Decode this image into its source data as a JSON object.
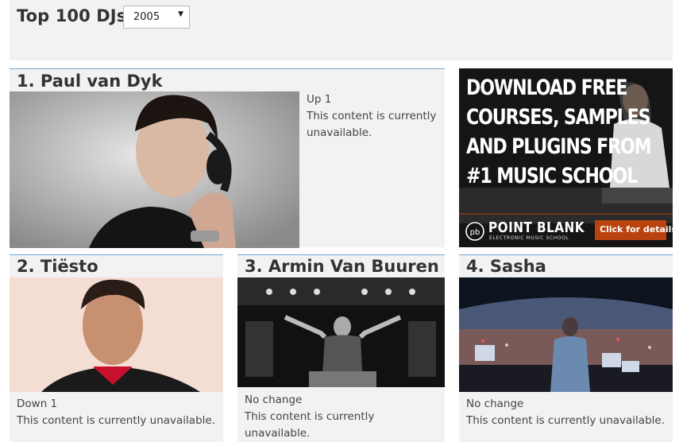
{
  "header": {
    "title": "Top 100 DJs",
    "year_select": {
      "value": "2005"
    }
  },
  "djs": [
    {
      "title": "1. Paul van Dyk",
      "change": "Up 1",
      "status": "This content is currently unavailable."
    },
    {
      "title": "2. Tiësto",
      "change": "Down 1",
      "status": "This content is currently unavailable."
    },
    {
      "title": "3. Armin Van Buuren",
      "change": "No change",
      "status": "This content is currently unavailable."
    },
    {
      "title": "4. Sasha",
      "change": "No change",
      "status": "This content is currently unavailable."
    }
  ],
  "ad": {
    "headline_lines": [
      "DOWNLOAD FREE",
      "COURSES, SAMPLES",
      "AND PLUGINS FROM",
      "#1 MUSIC SCHOOL"
    ],
    "brand": "POINT BLANK",
    "brand_sub": "ELECTRONIC MUSIC SCHOOL",
    "cta": "Click for details",
    "logo_text": "pb"
  },
  "colors": {
    "card_bg": "#f2f2f2",
    "card_border": "#6ea6d6",
    "ad_cta": "#b9420f"
  }
}
